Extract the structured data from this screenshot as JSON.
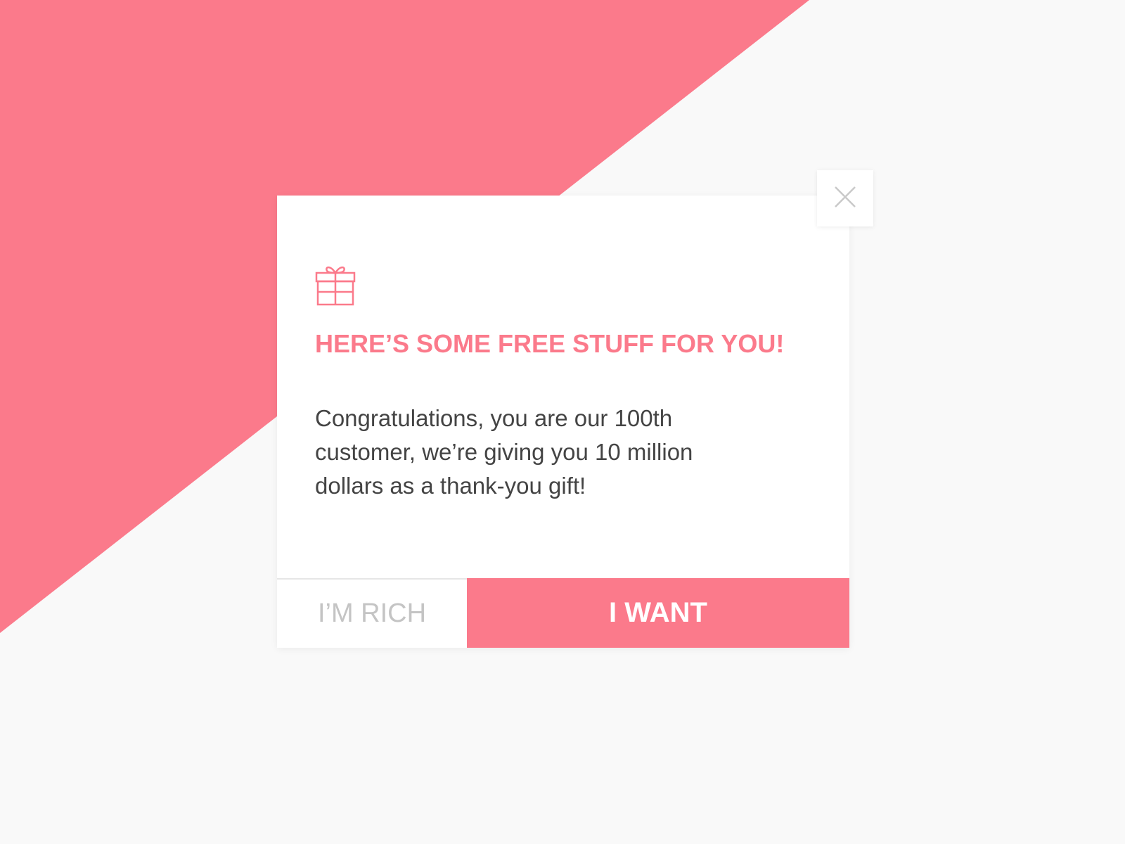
{
  "colors": {
    "accent": "#fb7a8b",
    "background": "#f9f9f9",
    "modal": "#ffffff",
    "body_text": "#444444",
    "secondary_text": "#c4c4c4"
  },
  "modal": {
    "icon": "gift-icon",
    "title": "HERE’S SOME FREE STUFF FOR YOU!",
    "body": "Congratulations, you are our 100th customer, we’re giving you 10 million dollars as a thank-you gift!",
    "secondary_button_label": "I’M RICH",
    "primary_button_label": "I WANT",
    "close_icon": "close-icon"
  }
}
